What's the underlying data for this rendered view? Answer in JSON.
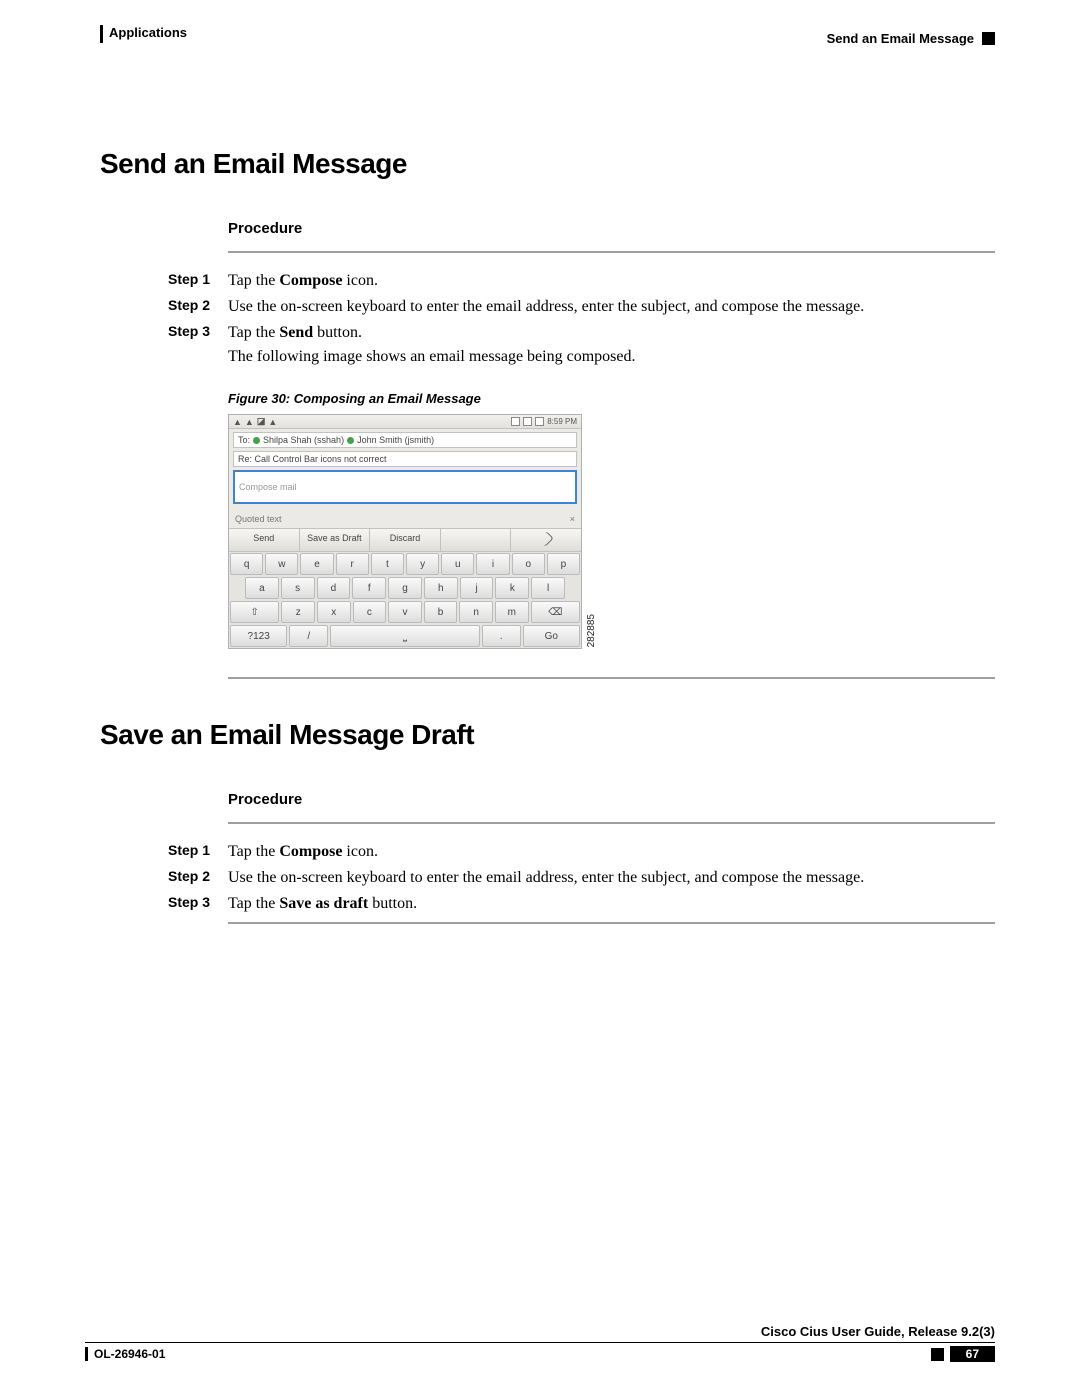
{
  "header": {
    "left": "Applications",
    "right": "Send an Email Message"
  },
  "section1": {
    "title": "Send an Email Message",
    "proc_label": "Procedure",
    "steps": [
      {
        "label": "Step 1",
        "text": "Tap the ",
        "bold": "Compose",
        "tail": " icon."
      },
      {
        "label": "Step 2",
        "text": "Use the on-screen keyboard to enter the email address, enter the subject, and compose the message."
      },
      {
        "label": "Step 3",
        "text": "Tap the ",
        "bold": "Send",
        "tail": " button.",
        "extra": "The following image shows an email message being composed."
      }
    ],
    "fig_caption": "Figure 30: Composing an Email Message",
    "fig_id": "282885",
    "compose_ui": {
      "time": "8:59 PM",
      "to_prefix": "To:",
      "recip1": "Shilpa Shah (sshah)",
      "recip2": "John Smith (jsmith)",
      "subject": "Re: Call Control Bar icons not correct",
      "compose_ph": "Compose mail",
      "quoted": "Quoted text",
      "btn_send": "Send",
      "btn_draft": "Save as Draft",
      "btn_discard": "Discard",
      "kb_r1": [
        "q",
        "w",
        "e",
        "r",
        "t",
        "y",
        "u",
        "i",
        "o",
        "p"
      ],
      "kb_r2": [
        "a",
        "s",
        "d",
        "f",
        "g",
        "h",
        "j",
        "k",
        "l"
      ],
      "kb_r3": [
        "z",
        "x",
        "c",
        "v",
        "b",
        "n",
        "m"
      ],
      "kb_r4_123": "?123",
      "kb_r4_slash": "/",
      "kb_r4_dot": ".",
      "kb_r4_go": "Go"
    }
  },
  "section2": {
    "title": "Save an Email Message Draft",
    "proc_label": "Procedure",
    "steps": [
      {
        "label": "Step 1",
        "text": "Tap the ",
        "bold": "Compose",
        "tail": " icon."
      },
      {
        "label": "Step 2",
        "text": "Use the on-screen keyboard to enter the email address, enter the subject, and compose the message."
      },
      {
        "label": "Step 3",
        "text": "Tap the ",
        "bold": "Save as draft",
        "tail": " button."
      }
    ]
  },
  "footer": {
    "guide": "Cisco Cius User Guide, Release 9.2(3)",
    "doc": "OL-26946-01",
    "page": "67"
  }
}
